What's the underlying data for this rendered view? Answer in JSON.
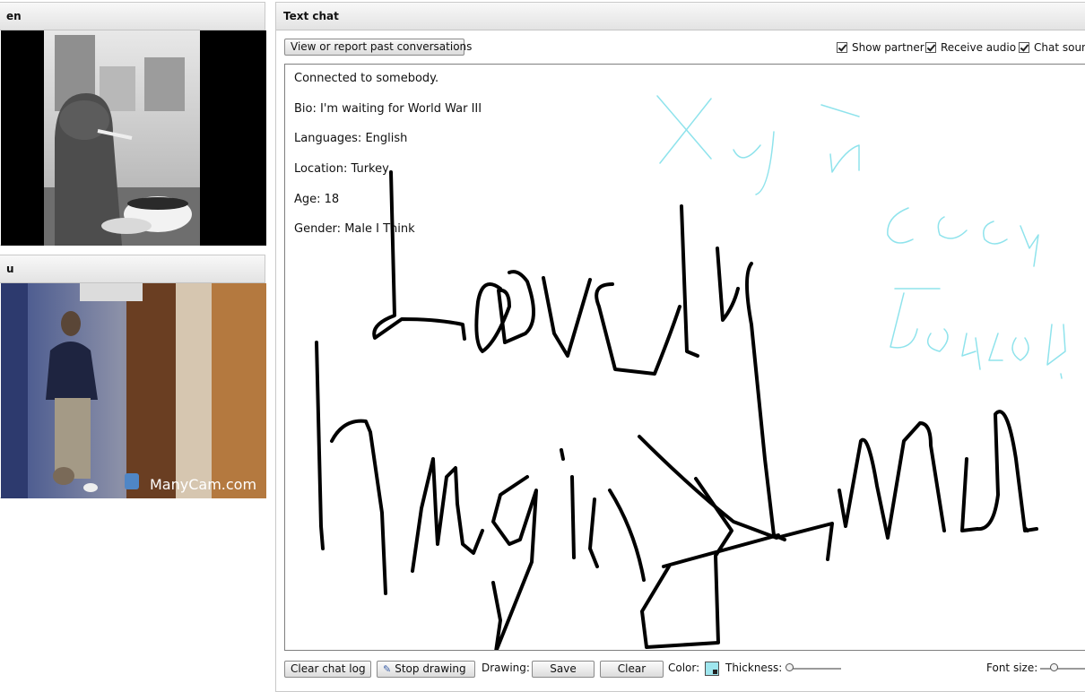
{
  "stranger_panel": {
    "title_fragment": "en"
  },
  "you_panel": {
    "title_fragment": "u",
    "watermark": "ManyCam.com"
  },
  "chat": {
    "title": "Text chat",
    "past_conversations_label": "View or report past conversations",
    "checkboxes": [
      {
        "label": "Show partner",
        "checked": true
      },
      {
        "label": "Receive audio",
        "checked": true
      },
      {
        "label": "Chat soun",
        "checked": true
      }
    ],
    "messages": [
      "Connected to somebody.",
      "Bio: I'm waiting for World War III",
      "Languages: English",
      "Location: Turkey",
      "Age: 18",
      "Gender: Male I Think"
    ],
    "drawing_strokes": {
      "black": "#000000",
      "cyan": "#8fe3ec"
    }
  },
  "toolbar": {
    "clear_log_label": "Clear chat log",
    "stop_drawing_label": "Stop drawing",
    "drawing_label": "Drawing:",
    "save_label": "Save",
    "clear_label": "Clear",
    "color_label": "Color:",
    "thickness_label": "Thickness:",
    "font_size_label": "Font size:"
  }
}
